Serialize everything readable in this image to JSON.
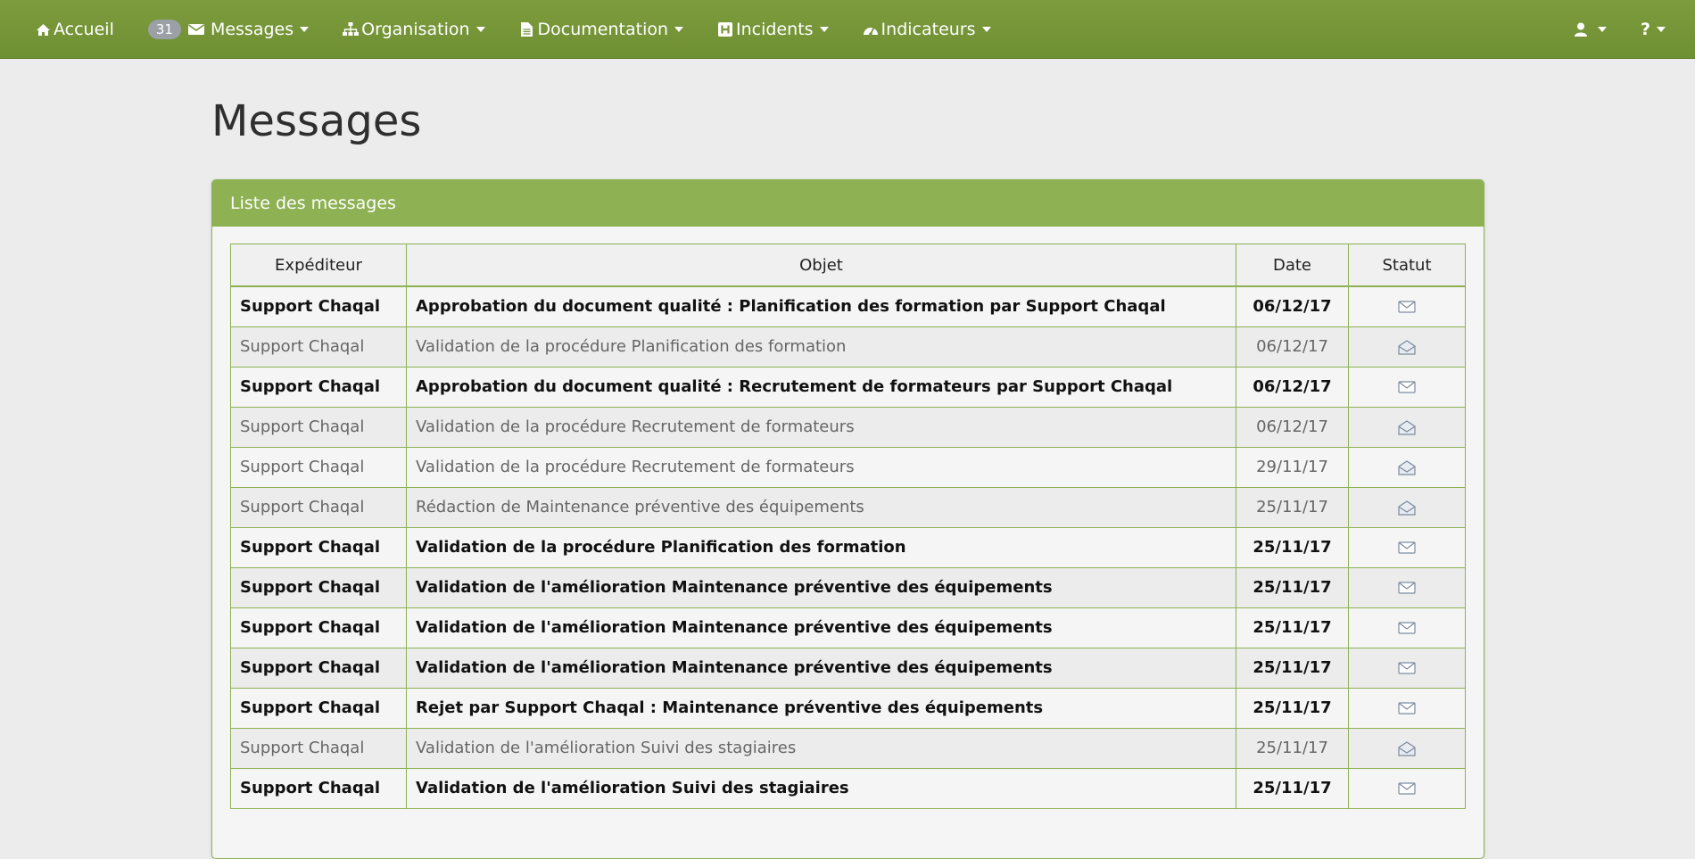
{
  "nav": {
    "home": "Accueil",
    "messages_count": "31",
    "messages": "Messages",
    "organisation": "Organisation",
    "documentation": "Documentation",
    "incidents": "Incidents",
    "indicateurs": "Indicateurs",
    "help": "?"
  },
  "page": {
    "title": "Messages"
  },
  "panel": {
    "title": "Liste des messages"
  },
  "table": {
    "headers": {
      "sender": "Expéditeur",
      "subject": "Objet",
      "date": "Date",
      "status": "Statut"
    },
    "rows": [
      {
        "sender": "Support Chaqal",
        "subject": "Approbation du document qualité : Planification des formation par Support Chaqal",
        "date": "06/12/17",
        "status": "unread"
      },
      {
        "sender": "Support Chaqal",
        "subject": "Validation de la procédure Planification des formation",
        "date": "06/12/17",
        "status": "read"
      },
      {
        "sender": "Support Chaqal",
        "subject": "Approbation du document qualité : Recrutement de formateurs par Support Chaqal",
        "date": "06/12/17",
        "status": "unread"
      },
      {
        "sender": "Support Chaqal",
        "subject": "Validation de la procédure Recrutement de formateurs",
        "date": "06/12/17",
        "status": "read"
      },
      {
        "sender": "Support Chaqal",
        "subject": "Validation de la procédure Recrutement de formateurs",
        "date": "29/11/17",
        "status": "read"
      },
      {
        "sender": "Support Chaqal",
        "subject": "Rédaction de Maintenance préventive des équipements",
        "date": "25/11/17",
        "status": "read"
      },
      {
        "sender": "Support Chaqal",
        "subject": "Validation de la procédure Planification des formation",
        "date": "25/11/17",
        "status": "unread"
      },
      {
        "sender": "Support Chaqal",
        "subject": "Validation de l'amélioration  Maintenance préventive des équipements",
        "date": "25/11/17",
        "status": "unread"
      },
      {
        "sender": "Support Chaqal",
        "subject": "Validation de l'amélioration  Maintenance préventive des équipements",
        "date": "25/11/17",
        "status": "unread"
      },
      {
        "sender": "Support Chaqal",
        "subject": "Validation de l'amélioration  Maintenance préventive des équipements",
        "date": "25/11/17",
        "status": "unread"
      },
      {
        "sender": "Support Chaqal",
        "subject": "Rejet par Support Chaqal : Maintenance préventive des équipements",
        "date": "25/11/17",
        "status": "unread"
      },
      {
        "sender": "Support Chaqal",
        "subject": "Validation de l'amélioration  Suivi des stagiaires",
        "date": "25/11/17",
        "status": "read"
      },
      {
        "sender": "Support Chaqal",
        "subject": "Validation de l'amélioration  Suivi des stagiaires",
        "date": "25/11/17",
        "status": "unread"
      }
    ]
  }
}
